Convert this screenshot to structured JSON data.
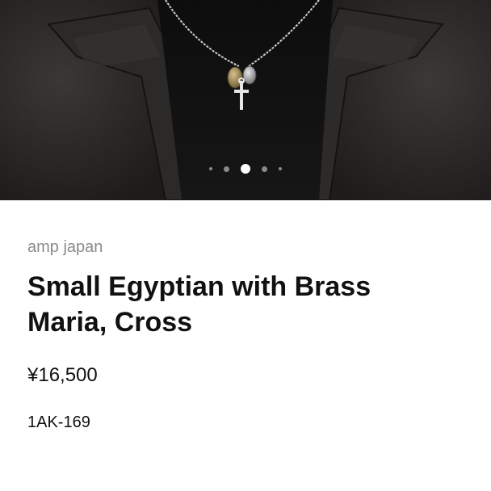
{
  "product": {
    "brand": "amp japan",
    "title": "Small Egyptian with Brass Maria, Cross",
    "price": "¥16,500",
    "sku": "1AK-169"
  },
  "gallery": {
    "image_count": 5,
    "active_index": 2
  },
  "colors": {
    "background": "#ffffff",
    "brand_text": "#8a8a8a",
    "text": "#111111",
    "hero_dark": "#121212"
  }
}
